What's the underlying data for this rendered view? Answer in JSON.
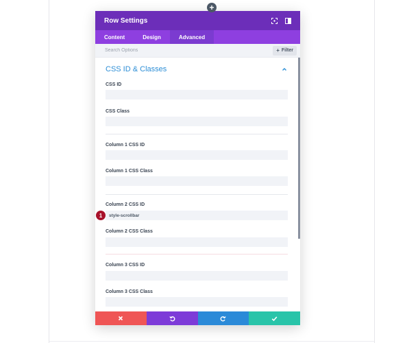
{
  "modal": {
    "title": "Row Settings",
    "tabs": [
      {
        "label": "Content",
        "active": false
      },
      {
        "label": "Design",
        "active": false
      },
      {
        "label": "Advanced",
        "active": true
      }
    ],
    "search": {
      "placeholder": "Search Options"
    },
    "filter_label": "Filter"
  },
  "section": {
    "title": "CSS ID & Classes",
    "fields": [
      {
        "label": "CSS ID",
        "value": ""
      },
      {
        "label": "CSS Class",
        "value": ""
      },
      {
        "label": "Column 1 CSS ID",
        "value": ""
      },
      {
        "label": "Column 1 CSS Class",
        "value": ""
      },
      {
        "label": "Column 2 CSS ID",
        "value": "style-scrollbar"
      },
      {
        "label": "Column 2 CSS Class",
        "value": ""
      },
      {
        "label": "Column 3 CSS ID",
        "value": ""
      },
      {
        "label": "Column 3 CSS Class",
        "value": ""
      }
    ]
  },
  "step_marker": "1",
  "colors": {
    "header": "#6c2eb9",
    "tabs": "#8e3fe0",
    "section_title": "#2c8ed6",
    "cancel": "#ef5555",
    "undo": "#7d3bd8",
    "redo": "#2b8ad8",
    "save": "#29c4a9",
    "marker": "#a8112a"
  },
  "icons": {
    "expand": "expand-icon",
    "sidebar": "sidebar-toggle-icon",
    "collapse": "chevron-up-icon",
    "cancel": "close-icon",
    "undo": "undo-icon",
    "redo": "redo-icon",
    "save": "check-icon"
  }
}
